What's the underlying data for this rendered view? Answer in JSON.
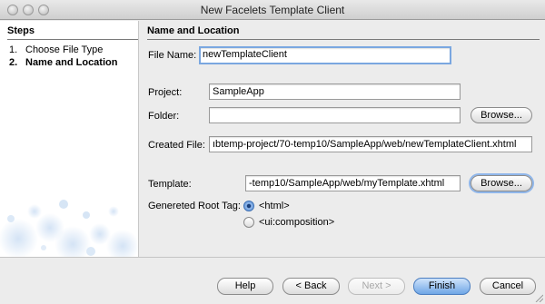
{
  "window": {
    "title": "New Facelets Template Client"
  },
  "steps": {
    "header": "Steps",
    "items": [
      {
        "num": "1.",
        "label": "Choose File Type"
      },
      {
        "num": "2.",
        "label": "Name and Location"
      }
    ]
  },
  "form": {
    "section_title": "Name and Location",
    "file_name_label": "File Name:",
    "file_name_value": "newTemplateClient",
    "project_label": "Project:",
    "project_value": "SampleApp",
    "folder_label": "Folder:",
    "folder_value": "",
    "folder_browse_label": "Browse...",
    "created_file_label": "Created File:",
    "created_file_value": "ıbtemp-project/70-temp10/SampleApp/web/newTemplateClient.xhtml",
    "template_label": "Template:",
    "template_value": "-temp10/SampleApp/web/myTemplate.xhtml",
    "template_browse_label": "Browse...",
    "root_tag_label": "Genereted Root Tag:",
    "root_tag_options": [
      {
        "label": "<html>",
        "checked": true
      },
      {
        "label": "<ui:composition>",
        "checked": false
      }
    ]
  },
  "buttons": {
    "help": "Help",
    "back": "< Back",
    "next": "Next >",
    "finish": "Finish",
    "cancel": "Cancel"
  },
  "colors": {
    "accent": "#6fa6e6",
    "focus": "#8fb6ea",
    "window_bg": "#ececec"
  }
}
